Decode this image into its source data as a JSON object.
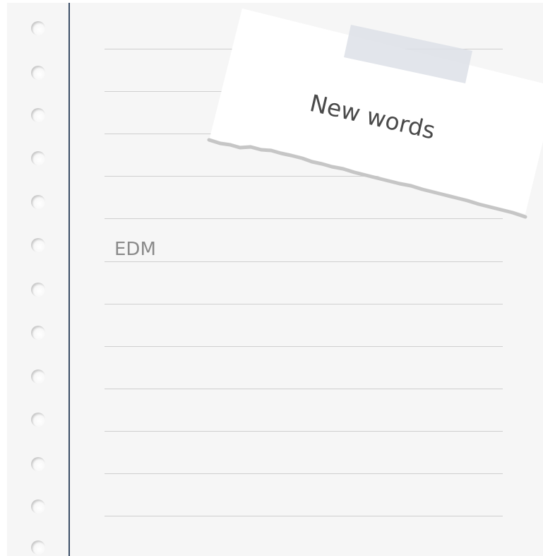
{
  "note": {
    "title": "New words"
  },
  "entries": [
    {
      "text": "EDM"
    }
  ],
  "theme": {
    "paper": "#f6f6f6",
    "margin_line": "#3a4d66",
    "rule_line": "#cfcfcf",
    "note_paper": "#ffffff",
    "tape": "#dde1e8",
    "entry_text": "#8a8a8a",
    "note_text": "#4a4a4a"
  }
}
